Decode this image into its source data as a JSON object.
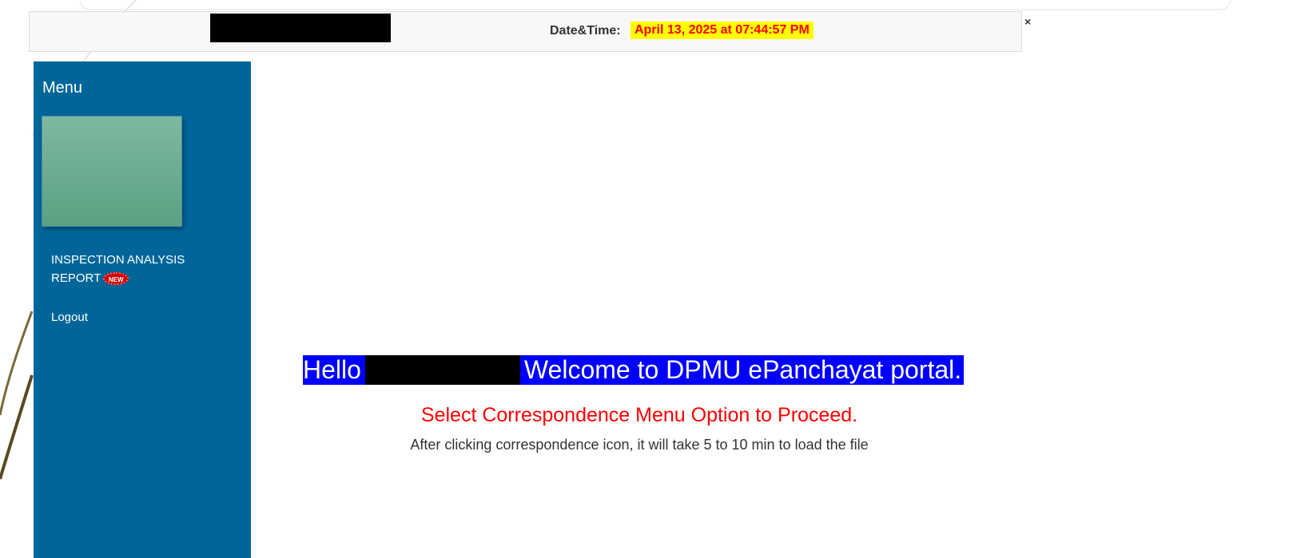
{
  "header": {
    "datetime_label": "Date&Time:",
    "datetime_value": "April 13, 2025 at 07:44:57 PM",
    "close_symbol": "×"
  },
  "sidebar": {
    "title": "Menu",
    "items": [
      {
        "label": "INSPECTION ANALYSIS REPORT",
        "badge": "NEW"
      },
      {
        "label": "Logout"
      }
    ]
  },
  "main": {
    "greeting": "Hello",
    "welcome_text": "Welcome to DPMU ePanchayat portal.",
    "instruction": "Select Correspondence Menu Option to Proceed.",
    "note": "After clicking correspondence icon, it will take 5 to 10 min to load the file"
  },
  "colors": {
    "sidebar_bg": "#006699",
    "welcome_bg": "#0000ff",
    "datetime_highlight": "#ffff00",
    "alert_red": "#ff0000"
  }
}
